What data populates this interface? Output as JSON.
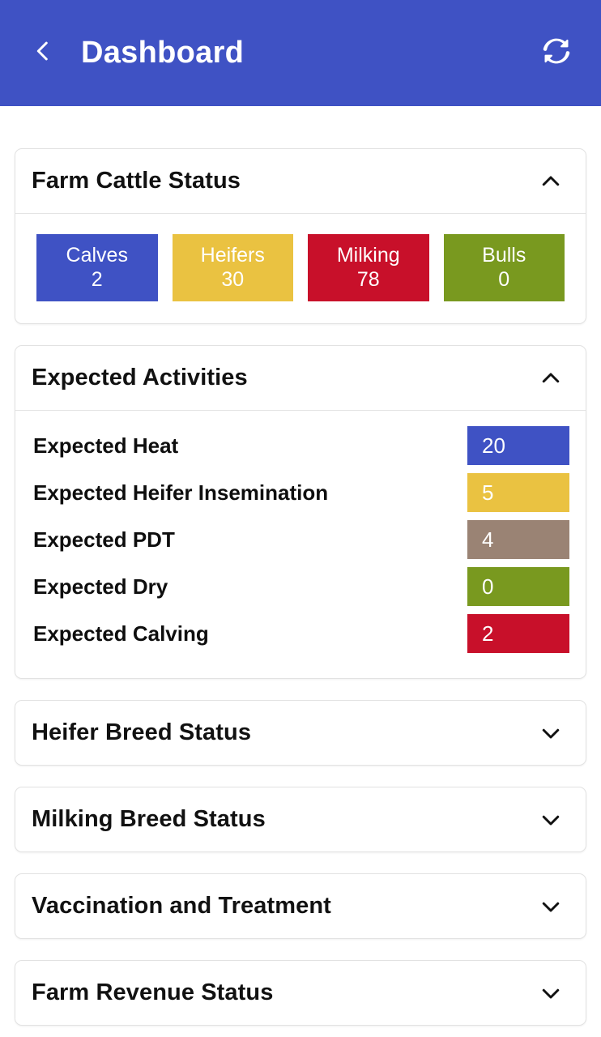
{
  "appbar": {
    "title": "Dashboard",
    "back_icon": "chevron-left-icon",
    "refresh_icon": "refresh-icon",
    "background_color": "#3f52c4",
    "text_color": "#ffffff"
  },
  "sections": [
    {
      "title": "Farm Cattle Status",
      "expanded": true,
      "chevron": "chevron-up-icon",
      "tiles": [
        {
          "label": "Calves",
          "value": "2",
          "color": "#3f52c4"
        },
        {
          "label": "Heifers",
          "value": "30",
          "color": "#eac241"
        },
        {
          "label": "Milking",
          "value": "78",
          "color": "#c8102a"
        },
        {
          "label": "Bulls",
          "value": "0",
          "color": "#79991f"
        }
      ]
    },
    {
      "title": "Expected Activities",
      "expanded": true,
      "chevron": "chevron-up-icon",
      "rows": [
        {
          "label": "Expected Heat",
          "value": "20",
          "color": "#3f52c4"
        },
        {
          "label": "Expected Heifer Insemination",
          "value": "5",
          "color": "#eac241"
        },
        {
          "label": "Expected PDT",
          "value": "4",
          "color": "#9a8374"
        },
        {
          "label": "Expected Dry",
          "value": "0",
          "color": "#79991f"
        },
        {
          "label": "Expected Calving",
          "value": "2",
          "color": "#c8102a"
        }
      ]
    },
    {
      "title": "Heifer Breed Status",
      "expanded": false,
      "chevron": "chevron-down-icon"
    },
    {
      "title": "Milking Breed Status",
      "expanded": false,
      "chevron": "chevron-down-icon"
    },
    {
      "title": "Vaccination and Treatment",
      "expanded": false,
      "chevron": "chevron-down-icon"
    },
    {
      "title": "Farm Revenue Status",
      "expanded": false,
      "chevron": "chevron-down-icon"
    }
  ]
}
